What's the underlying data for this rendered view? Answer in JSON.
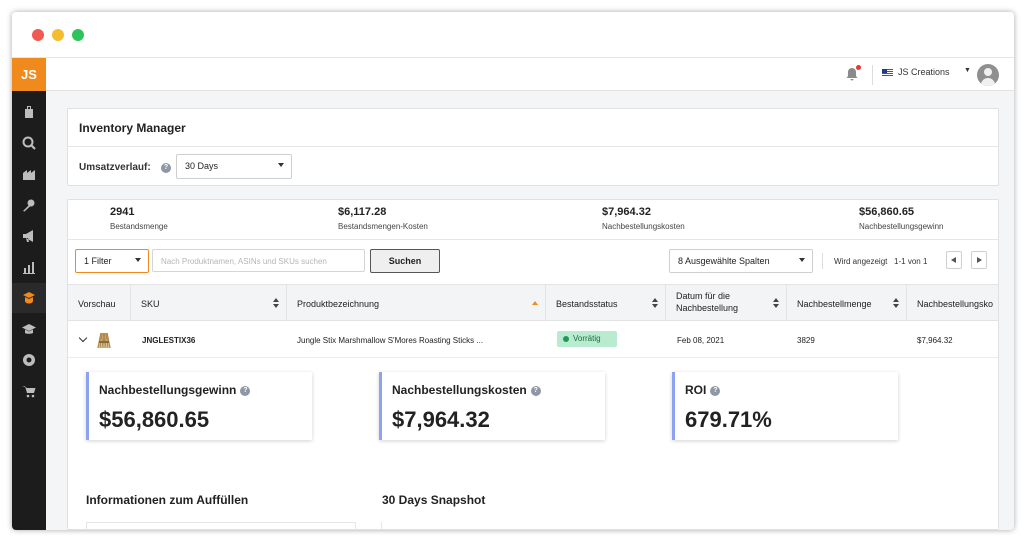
{
  "app": {
    "logo": "JS",
    "account_name": "JS Creations"
  },
  "sidebar": {
    "icons": [
      "product-database-icon",
      "opportunity-finder-icon",
      "supplier-database-icon",
      "keyword-scout-icon",
      "marketing-icon",
      "sales-analytics-icon",
      "inventory-manager-icon",
      "academy-icon",
      "chrome-extension-icon",
      "cart-icon"
    ],
    "active": "inventory-manager-icon"
  },
  "page": {
    "title": "Inventory Manager",
    "sales_history_label": "Umsatzverlauf:",
    "sales_history_value": "30 Days"
  },
  "stats": [
    {
      "value": "2941",
      "label": "Bestandsmenge"
    },
    {
      "value": "$6,117.28",
      "label": "Bestandsmengen-Kosten"
    },
    {
      "value": "$7,964.32",
      "label": "Nachbestellungskosten"
    },
    {
      "value": "$56,860.65",
      "label": "Nachbestellungsgewinn"
    }
  ],
  "toolbar": {
    "filter_label": "1 Filter",
    "search_placeholder": "Nach Produktnamen, ASINs und SKUs suchen",
    "search_button": "Suchen",
    "columns_select": "8 Ausgewählte Spalten",
    "shown_label": "Wird angezeigt",
    "shown_range": "1-1 von 1"
  },
  "table": {
    "headers": [
      "Vorschau",
      "SKU",
      "Produktbezeichnung",
      "Bestandsstatus",
      "Datum für die Nachbestellung",
      "Nachbestellmenge",
      "Nachbestellungsko"
    ],
    "row": {
      "sku": "JNGLESTIX36",
      "product": "Jungle Stix Marshmallow S'Mores Roasting Sticks ...",
      "status": "Vorrätig",
      "reorder_date": "Feb 08, 2021",
      "reorder_qty": "3829",
      "reorder_cost": "$7,964.32"
    }
  },
  "detail": {
    "cards": [
      {
        "title": "Nachbestellungsgewinn",
        "value": "$56,860.65"
      },
      {
        "title": "Nachbestellungskosten",
        "value": "$7,964.32"
      },
      {
        "title": "ROI",
        "value": "679.71%"
      }
    ],
    "section_restock": "Informationen zum Auffüllen",
    "section_snapshot": "30 Days Snapshot"
  },
  "colors": {
    "brand": "#f08a1d",
    "sidebar": "#1c1c1c",
    "card_accent": "#8ea2f2",
    "status_bg": "#b8ebcf"
  }
}
